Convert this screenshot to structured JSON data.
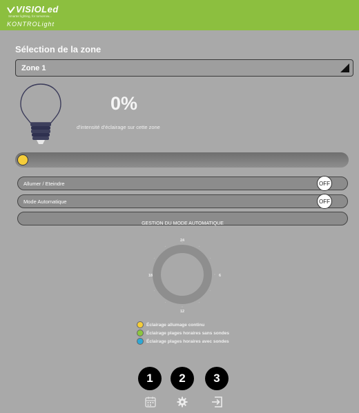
{
  "brand": {
    "name": "VISIOLed",
    "tagline": "Smarter lighting, for tomorrow...",
    "subtitle": "KONTROLight",
    "header_color": "#8cbf3f"
  },
  "zone": {
    "title": "Sélection de la zone",
    "selected": "Zone 1"
  },
  "intensity": {
    "value": "0%",
    "label": "d'intensité d'éclairage sur cette zone",
    "slider_fraction": 0
  },
  "controls": {
    "power_label": "Allumer / Eteindre",
    "power_state": "OFF",
    "auto_label": "Mode Automatique",
    "auto_state": "OFF",
    "gestion_label": "GESTION DU MODE AUTOMATIQUE"
  },
  "dial": {
    "top": "24",
    "right": "6",
    "bottom": "12",
    "left": "18"
  },
  "legend": [
    {
      "label": "Éclairage allumage continu",
      "color": "#f5cd3a"
    },
    {
      "label": "Éclairage plages horaires sans sondes",
      "color": "#8cc63f"
    },
    {
      "label": "Éclairage plages horaires avec sondes",
      "color": "#2ea8d6"
    }
  ],
  "badges": [
    "1",
    "2",
    "3"
  ],
  "nav": {
    "icons": [
      "calendar-icon",
      "gear-icon",
      "logout-icon"
    ]
  }
}
